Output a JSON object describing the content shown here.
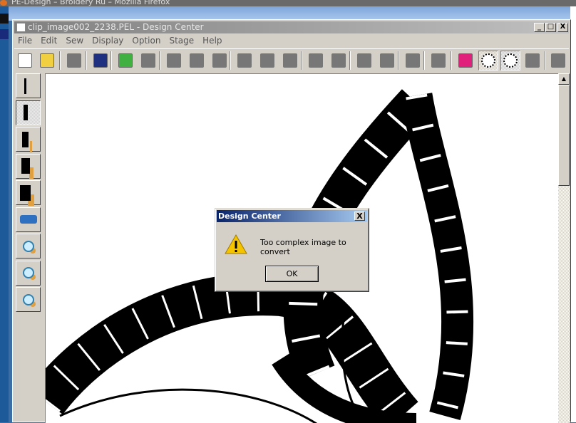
{
  "browser": {
    "title": "PE-Design – Broidery Ru – Mozilla Firefox"
  },
  "window": {
    "title": "clip_image002_2238.PEL - Design Center",
    "controls": {
      "minimize": "_",
      "maximize": "□",
      "close": "X"
    }
  },
  "menu": [
    "File",
    "Edit",
    "Sew",
    "Display",
    "Option",
    "Stage",
    "Help"
  ],
  "toolbar": [
    "new-icon",
    "open-icon",
    "import-icon",
    "save-icon",
    "undo-icon",
    "redo-icon",
    "cut-icon",
    "copy-icon",
    "paste-icon",
    "rotate-left-icon",
    "flip-icon",
    "rotate-icon",
    "frame-icon",
    "numbered-icon",
    "display-icon",
    "monitor-icon",
    "sew-icon",
    "window-icon",
    "flower-color-icon",
    "flower-outline-icon",
    "flower-dots-icon",
    "silhouette-icon",
    "export-icon"
  ],
  "left_tools": [
    "pen-thin-icon",
    "pen-medium-icon",
    "pen-thick-icon",
    "pen-thicker-icon",
    "pen-thickest-icon",
    "eraser-icon",
    "zoom-in-icon",
    "zoom-fit-icon",
    "zoom-out-icon"
  ],
  "dialog": {
    "title": "Design Center",
    "close": "X",
    "message": "Too complex image to convert",
    "ok_label": "OK"
  }
}
